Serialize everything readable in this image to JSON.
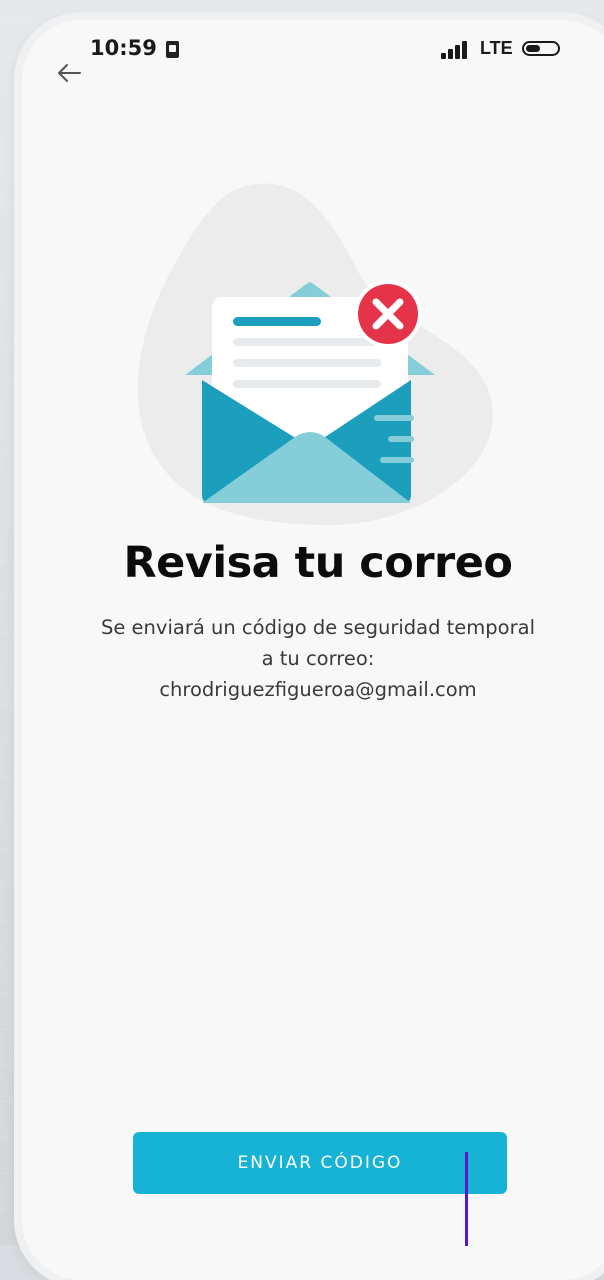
{
  "status_bar": {
    "time": "10:59",
    "network": "LTE"
  },
  "icons": {
    "back": "arrow-left-icon",
    "sim": "sim-card-icon",
    "signal": "cellular-signal-icon",
    "battery": "battery-icon",
    "error": "close-circle-icon"
  },
  "colors": {
    "accent": "#17b3d6",
    "error": "#e5344a",
    "envelope_dark": "#1b9fbd",
    "envelope_light": "#86cdda"
  },
  "main": {
    "title": "Revisa tu correo",
    "description_line1": "Se enviará un código de seguridad temporal",
    "description_line2": "a tu correo:",
    "email": "chrodriguezfigueroa@gmail.com"
  },
  "actions": {
    "send_code_label": "ENVIAR CÓDIGO"
  }
}
